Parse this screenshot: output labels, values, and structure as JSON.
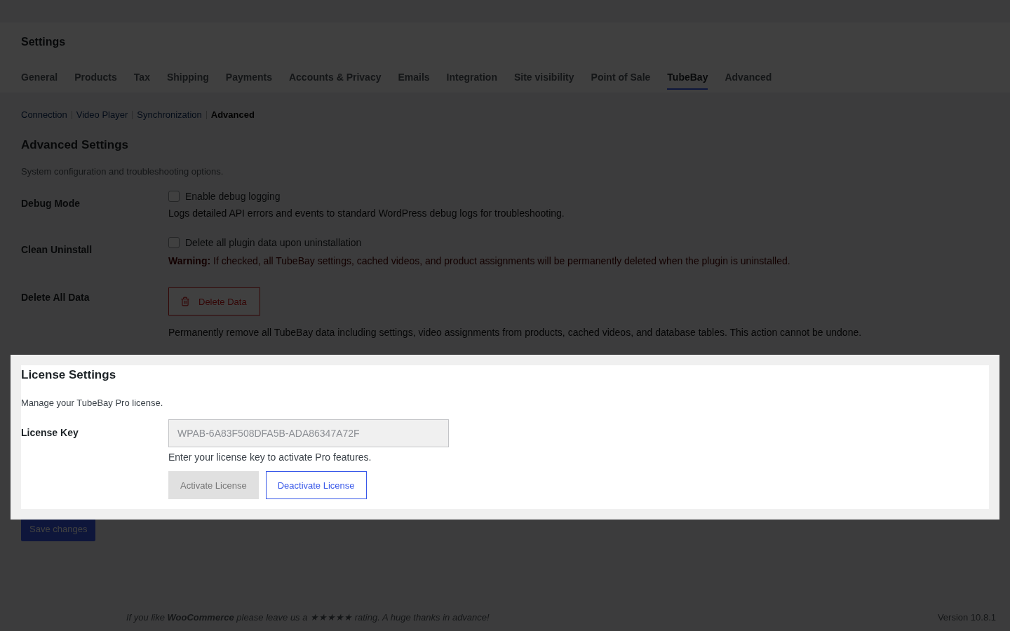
{
  "page_title": "Settings",
  "tabs": [
    {
      "label": "General",
      "selected": false
    },
    {
      "label": "Products",
      "selected": false
    },
    {
      "label": "Tax",
      "selected": false
    },
    {
      "label": "Shipping",
      "selected": false
    },
    {
      "label": "Payments",
      "selected": false
    },
    {
      "label": "Accounts & Privacy",
      "selected": false
    },
    {
      "label": "Emails",
      "selected": false
    },
    {
      "label": "Integration",
      "selected": false
    },
    {
      "label": "Site visibility",
      "selected": false
    },
    {
      "label": "Point of Sale",
      "selected": false
    },
    {
      "label": "TubeBay",
      "selected": true
    },
    {
      "label": "Advanced",
      "selected": false
    }
  ],
  "subnav": [
    {
      "label": "Connection",
      "selected": false
    },
    {
      "label": "Video Player",
      "selected": false
    },
    {
      "label": "Synchronization",
      "selected": false
    },
    {
      "label": "Advanced",
      "selected": true
    }
  ],
  "section": {
    "title": "Advanced Settings",
    "description": "System configuration and troubleshooting options.",
    "rows": [
      {
        "kind": "checkbox",
        "label": "Debug Mode",
        "option": "Enable debug logging",
        "checked": false,
        "help": "Logs detailed API errors and events to standard WordPress debug logs for troubleshooting."
      },
      {
        "kind": "checkbox",
        "label": "Clean Uninstall",
        "option": "Delete all plugin data upon uninstallation",
        "checked": false,
        "warning": "**Warning:** If checked, all TubeBay settings, cached videos, and product assignments will be permanently deleted when the plugin is uninstalled."
      },
      {
        "kind": "button",
        "label": "Delete All Data",
        "button": "Delete Data",
        "help": "Permanently remove all TubeBay data including settings, video assignments from products, cached videos, and database tables. This action cannot be undone."
      }
    ]
  },
  "license": {
    "title": "License Settings",
    "description": "Manage your TubeBay Pro license.",
    "label": "License Key",
    "value": "WPAB-6A83F508DFA5B-ADA86347A72F",
    "readonly": true,
    "help": "Enter your license key to activate Pro features.",
    "buttons": [
      {
        "label": "Activate License",
        "disabled": true
      },
      {
        "label": "Deactivate License",
        "disabled": false
      }
    ]
  },
  "save_button": "Save changes",
  "footer": {
    "text": "If you like **WooCommerce** please leave us a ★★★★★ rating. A huge thanks in advance!",
    "version": "Version 10.8.1"
  }
}
